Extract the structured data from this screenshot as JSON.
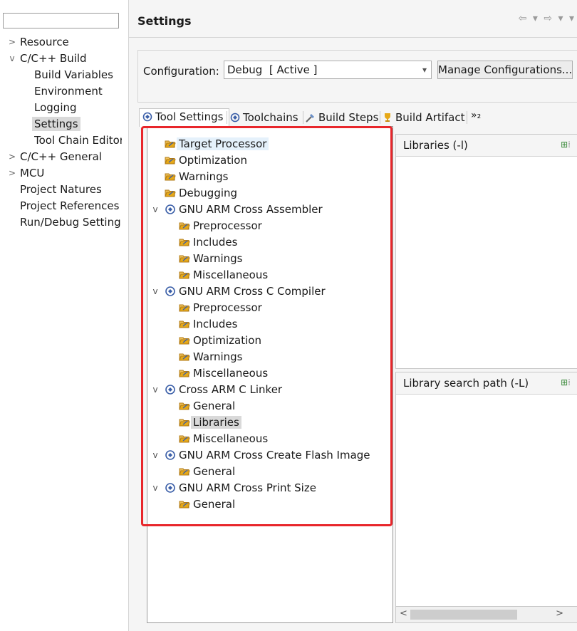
{
  "nav": {
    "filter_value": "",
    "items": [
      {
        "label": "Resource",
        "toggle": ">"
      },
      {
        "label": "C/C++ Build",
        "toggle": "v"
      },
      {
        "label": "Build Variables"
      },
      {
        "label": "Environment"
      },
      {
        "label": "Logging"
      },
      {
        "label": "Settings"
      },
      {
        "label": "Tool Chain Editor"
      },
      {
        "label": "C/C++ General",
        "toggle": ">"
      },
      {
        "label": "MCU",
        "toggle": ">"
      },
      {
        "label": "Project Natures"
      },
      {
        "label": "Project References"
      },
      {
        "label": "Run/Debug Setting"
      }
    ]
  },
  "header": {
    "title": "Settings",
    "nav_back": "⇦ ▾ ⇨ ▾ ▾"
  },
  "config": {
    "label": "Configuration:",
    "selected": "Debug  [ Active ]",
    "manage_label": "Manage Configurations..."
  },
  "tabs": {
    "items": [
      {
        "label": "Tool Settings",
        "icon": "tool-settings-icon"
      },
      {
        "label": "Toolchains",
        "icon": "toolchains-icon"
      },
      {
        "label": "Build Steps",
        "icon": "build-steps-icon"
      },
      {
        "label": "Build Artifact",
        "icon": "build-artifact-icon"
      }
    ],
    "overflow": "»₂"
  },
  "tree": {
    "rows": [
      {
        "label": "Target Processor"
      },
      {
        "label": "Optimization"
      },
      {
        "label": "Warnings"
      },
      {
        "label": "Debugging"
      },
      {
        "label": "GNU ARM Cross Assembler",
        "toggle": "v"
      },
      {
        "label": "Preprocessor"
      },
      {
        "label": "Includes"
      },
      {
        "label": "Warnings"
      },
      {
        "label": "Miscellaneous"
      },
      {
        "label": "GNU ARM Cross C Compiler",
        "toggle": "v"
      },
      {
        "label": "Preprocessor"
      },
      {
        "label": "Includes"
      },
      {
        "label": "Optimization"
      },
      {
        "label": "Warnings"
      },
      {
        "label": "Miscellaneous"
      },
      {
        "label": "Cross ARM C Linker",
        "toggle": "v"
      },
      {
        "label": "General"
      },
      {
        "label": "Libraries"
      },
      {
        "label": "Miscellaneous"
      },
      {
        "label": "GNU ARM Cross Create Flash Image",
        "toggle": "v"
      },
      {
        "label": "General"
      },
      {
        "label": "GNU ARM Cross Print Size",
        "toggle": "v"
      },
      {
        "label": "General"
      }
    ]
  },
  "libraries": {
    "title": "Libraries (-l)",
    "search_title": "Library search path (-L)",
    "scroll_left": "<",
    "scroll_right": ">"
  },
  "colors": {
    "highlight_box": "#e8262b",
    "folder": "#d99a2b",
    "tool": "#3b5fa8"
  }
}
